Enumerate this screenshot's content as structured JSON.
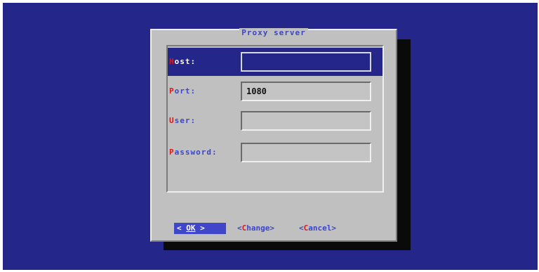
{
  "dialog": {
    "title": "Proxy server"
  },
  "fields": [
    {
      "label_hotkey": "H",
      "label_rest": "ost:",
      "value": ""
    },
    {
      "label_hotkey": "P",
      "label_rest": "ort:",
      "value": "1080"
    },
    {
      "label_hotkey": "U",
      "label_rest": "ser:",
      "value": ""
    },
    {
      "label_hotkey": "P",
      "label_rest": "assword:",
      "value": ""
    }
  ],
  "buttons": {
    "ok": {
      "left": "< ",
      "hotkey": "OK",
      "right": " >"
    },
    "change": {
      "left": "<",
      "hotkey": "C",
      "right": "hange>"
    },
    "cancel": {
      "left": "<",
      "hotkey": "C",
      "right": "ancel>"
    }
  },
  "colors": {
    "background": "#25268a",
    "dialog": "#c0c0c0",
    "hotkey": "#d61a1a",
    "label": "#3b46c7",
    "selected_button": "#3f46c9"
  }
}
